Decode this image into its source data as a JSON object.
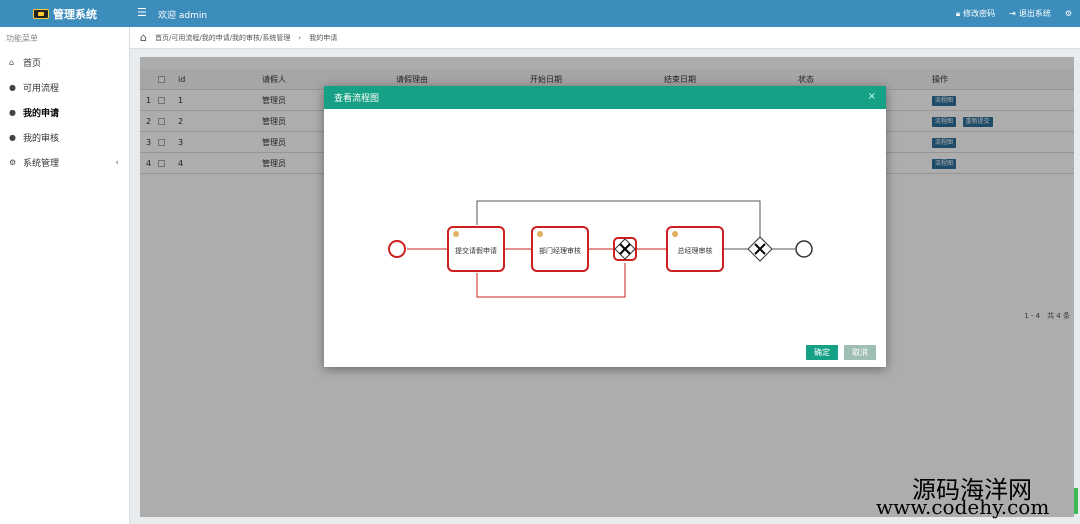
{
  "header": {
    "brand": "管理系统",
    "menu_icon": "menu-icon",
    "welcome": "欢迎 admin",
    "change_password": "修改密码",
    "logout": "退出系统",
    "settings_icon": "gears-icon"
  },
  "sidebar": {
    "title": "功能菜单",
    "items": [
      {
        "label": "首页",
        "icon": "home-icon"
      },
      {
        "label": "可用流程",
        "icon": "user-icon"
      },
      {
        "label": "我的申请",
        "icon": "user-icon"
      },
      {
        "label": "我的审核",
        "icon": "user-icon"
      },
      {
        "label": "系统管理",
        "icon": "gear-icon"
      }
    ]
  },
  "breadcrumb": {
    "path": "首页/可用流程/我的申请/我的审核/系统管理",
    "current": "我的申请"
  },
  "table": {
    "columns": [
      "",
      "id",
      "请假人",
      "请假理由",
      "开始日期",
      "结束日期",
      "状态",
      "操作"
    ],
    "rows": [
      {
        "no": "1",
        "id": "1",
        "person": "管理员",
        "ops": [
          "流程图"
        ]
      },
      {
        "no": "2",
        "id": "2",
        "person": "管理员",
        "ops": [
          "流程图",
          "重新提交"
        ]
      },
      {
        "no": "3",
        "id": "3",
        "person": "管理员",
        "ops": [
          "流程图"
        ]
      },
      {
        "no": "4",
        "id": "4",
        "person": "管理员",
        "ops": [
          "流程图"
        ]
      }
    ],
    "pager": "1 - 4　共 4 条"
  },
  "modal": {
    "title": "查看流程图",
    "close": "×",
    "ok": "确定",
    "cancel": "取消"
  },
  "flow": {
    "tasks": [
      "提交请假申请",
      "部门经理审核",
      "总经理审核"
    ]
  },
  "watermark": {
    "line1": "源码海洋网",
    "line2": "www.codehy.com"
  },
  "colors": {
    "topbar": "#3c8dbc",
    "modal_header": "#16a085",
    "flow_highlight": "#cc1f1f"
  }
}
